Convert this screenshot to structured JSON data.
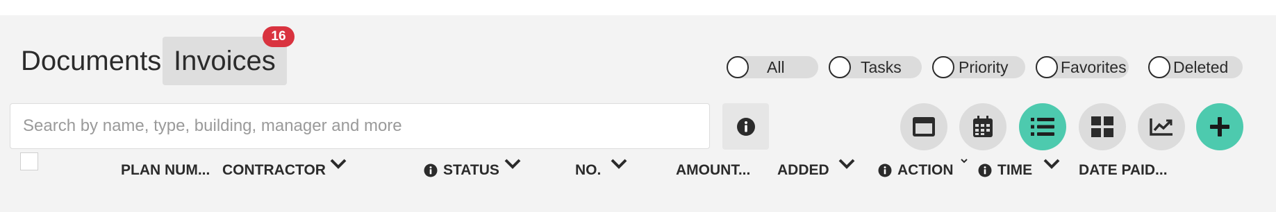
{
  "tabs": [
    {
      "label": "Documents"
    },
    {
      "label": "Invoices",
      "badge": "16"
    }
  ],
  "filters": [
    {
      "label": "All",
      "checked": false
    },
    {
      "label": "Tasks",
      "checked": false
    },
    {
      "label": "Priority",
      "checked": false
    },
    {
      "label": "Favorites",
      "checked": false
    },
    {
      "label": "Deleted",
      "checked": false
    }
  ],
  "search": {
    "placeholder": "Search by name, type, building, manager and more",
    "value": ""
  },
  "view_buttons": [
    {
      "icon": "card-view-icon",
      "active": false
    },
    {
      "icon": "calendar-icon",
      "active": false
    },
    {
      "icon": "list-view-icon",
      "active": true
    },
    {
      "icon": "grid-view-icon",
      "active": false
    },
    {
      "icon": "chart-icon",
      "active": false
    },
    {
      "icon": "plus-icon",
      "active": true
    }
  ],
  "columns": [
    {
      "label": "PLAN NUM..."
    },
    {
      "label": "CONTRACTOR"
    },
    {
      "label": "STATUS"
    },
    {
      "label": "NO."
    },
    {
      "label": "AMOUNT..."
    },
    {
      "label": "ADDED"
    },
    {
      "label": "ACTION"
    },
    {
      "label": "TIME"
    },
    {
      "label": "DATE PAID..."
    }
  ],
  "colors": {
    "accent": "#4dcaae",
    "badge": "#d9333f",
    "panel_bg": "#f3f3f3"
  }
}
